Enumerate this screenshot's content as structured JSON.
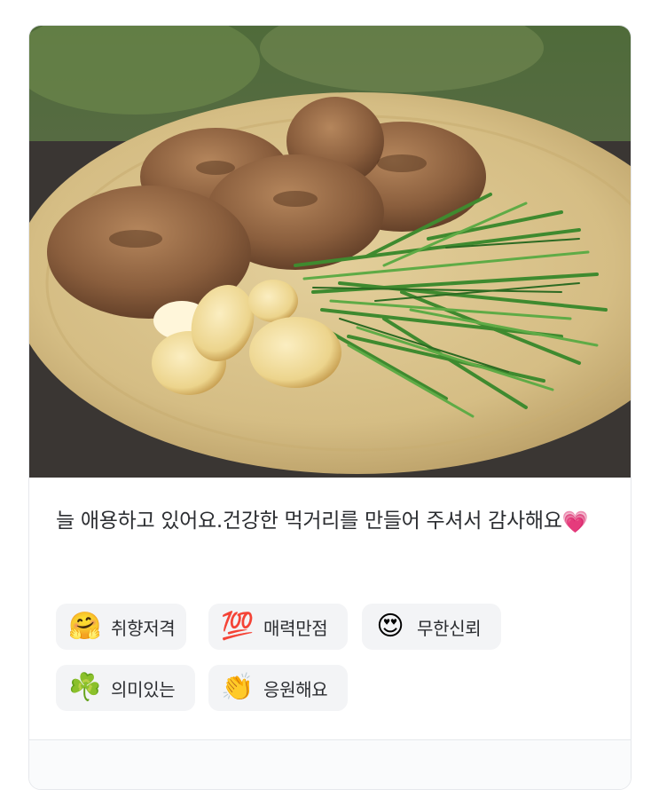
{
  "review": {
    "text": "늘 애용하고 있어요.건강한 먹거리를 만들어 주셔서 감사해요",
    "heart_emoji": "💗"
  },
  "reactions": [
    {
      "emoji": "🤗",
      "label": "취향저격"
    },
    {
      "emoji": "💯",
      "label": "매력만점"
    },
    {
      "emoji": "😍",
      "label": "무한신뢰"
    },
    {
      "emoji": "☘️",
      "label": "의미있는"
    },
    {
      "emoji": "👏",
      "label": "응원해요"
    }
  ]
}
